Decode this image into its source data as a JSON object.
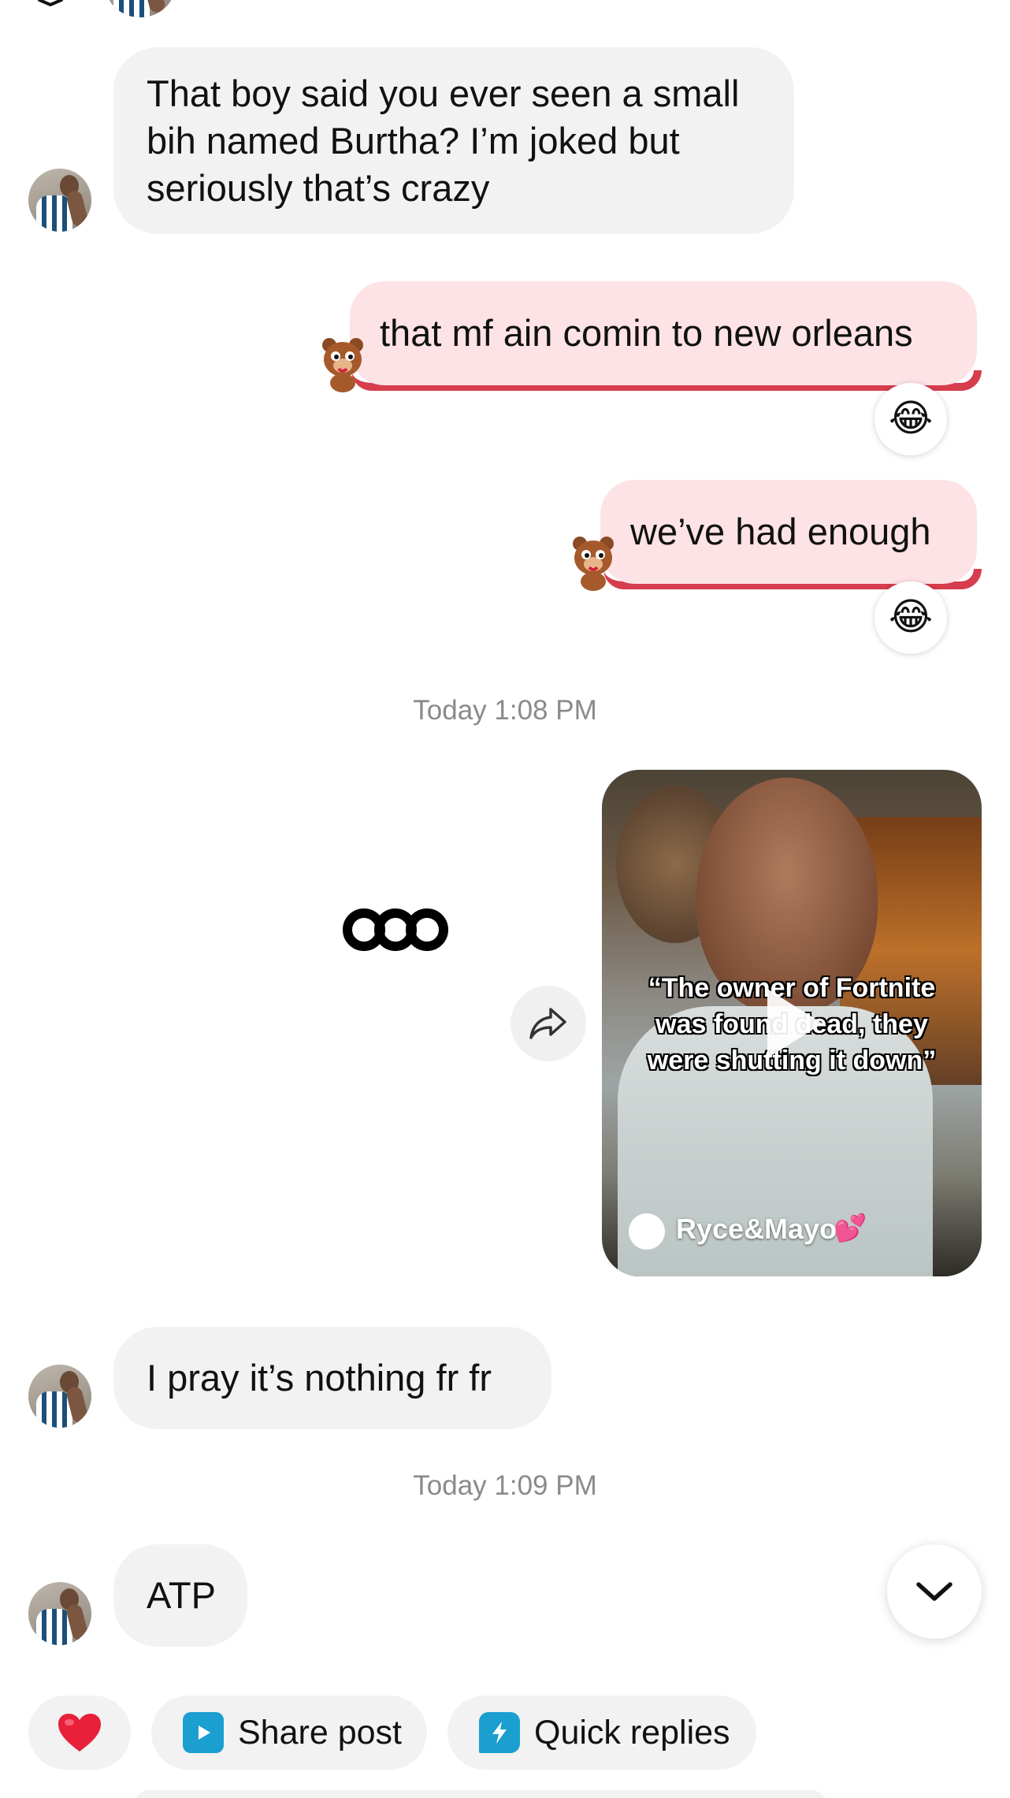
{
  "colors": {
    "incoming_bubble": "#f2f2f2",
    "outgoing_bubble": "#fde3e6",
    "outgoing_accent": "#d63d4d",
    "timestamp_text": "#8a8a8a",
    "share_post_icon": "#1a9fd0",
    "quick_replies_icon": "#1a9fd0",
    "heart": "#e8203a"
  },
  "messages": {
    "m1": {
      "from": "them",
      "lines": [
        "That boy said you ever seen a small",
        "bih named Burtha? I’m joked but",
        "seriously that’s crazy"
      ]
    },
    "m2": {
      "from": "me",
      "text": "that mf ain comin to new orleans",
      "reaction": "😂"
    },
    "m3": {
      "from": "me",
      "text": "we’ve had enough",
      "reaction": "😂"
    },
    "ts1": "Today 1:08 PM",
    "shared_video": {
      "caption_lines": [
        "“The owner of Fortnite",
        "was found dead, they",
        "were shutting it down”"
      ],
      "author": "Ryce&Mayo",
      "author_emoji": "💕"
    },
    "m4": {
      "from": "them",
      "text": "I pray it’s nothing fr fr"
    },
    "ts2": "Today 1:09 PM",
    "m5": {
      "from": "them",
      "text": "ATP"
    }
  },
  "quick_actions": {
    "heart_icon": "heart-icon",
    "share_post": "Share post",
    "quick_replies": "Quick replies"
  },
  "icons": [
    "profile-avatar",
    "bear-sticker-icon",
    "laugh-cry-emoji",
    "threads-logo-icon",
    "share-arrow-icon",
    "play-icon",
    "chevron-down-icon",
    "heart-icon",
    "share-post-icon",
    "quick-replies-icon"
  ]
}
